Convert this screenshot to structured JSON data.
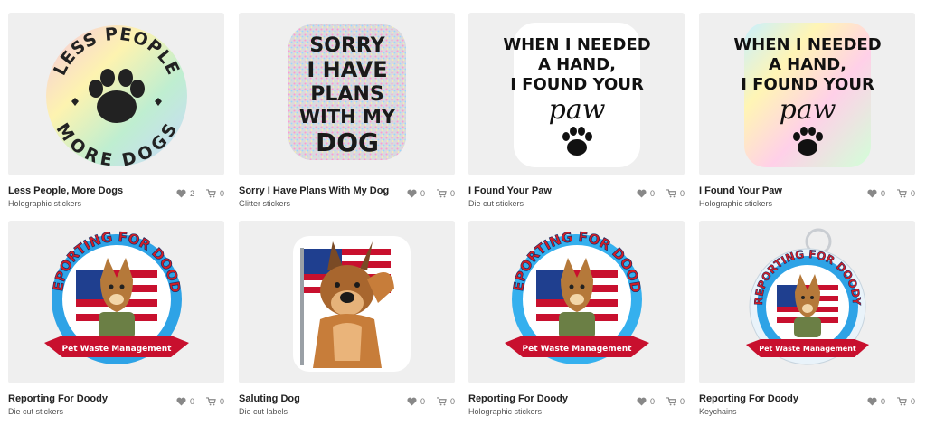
{
  "products": [
    {
      "title": "Less People, More Dogs",
      "subtitle": "Holographic stickers",
      "likes": "2",
      "cart": "0",
      "art": {
        "kind": "circle",
        "lines": [
          "LESS PEOPLE",
          "MORE DOGS"
        ]
      }
    },
    {
      "title": "Sorry I Have Plans With My Dog",
      "subtitle": "Glitter stickers",
      "likes": "0",
      "cart": "0",
      "art": {
        "kind": "glitter",
        "lines": [
          "SORRY",
          "I HAVE",
          "PLANS",
          "WITH MY",
          "DOG"
        ]
      }
    },
    {
      "title": "I Found Your Paw",
      "subtitle": "Die cut stickers",
      "likes": "0",
      "cart": "0",
      "art": {
        "kind": "paw-text",
        "lines": [
          "WHEN I NEEDED",
          "A HAND,",
          "I FOUND YOUR",
          "paw"
        ]
      }
    },
    {
      "title": "I Found Your Paw",
      "subtitle": "Holographic stickers",
      "likes": "0",
      "cart": "0",
      "art": {
        "kind": "paw-text-holo",
        "lines": [
          "WHEN I NEEDED",
          "A HAND,",
          "I FOUND YOUR",
          "paw"
        ]
      }
    },
    {
      "title": "Reporting For Doody",
      "subtitle": "Die cut stickers",
      "likes": "0",
      "cart": "0",
      "art": {
        "kind": "badge",
        "lines": [
          "REPORTING FOR DOODY",
          "Pet Waste Management"
        ]
      }
    },
    {
      "title": "Saluting Dog",
      "subtitle": "Die cut labels",
      "likes": "0",
      "cart": "0",
      "art": {
        "kind": "salute"
      }
    },
    {
      "title": "Reporting For Doody",
      "subtitle": "Holographic stickers",
      "likes": "0",
      "cart": "0",
      "art": {
        "kind": "badge",
        "lines": [
          "REPORTING FOR DOODY",
          "Pet Waste Management"
        ]
      }
    },
    {
      "title": "Reporting For Doody",
      "subtitle": "Keychains",
      "likes": "0",
      "cart": "0",
      "art": {
        "kind": "badge-key",
        "lines": [
          "REPORTING FOR DOODY",
          "Pet Waste Management"
        ]
      }
    }
  ],
  "colors": {
    "thumb_bg": "#efefef",
    "flag_red": "#c8102e",
    "flag_blue": "#1f3f8f",
    "badge_ring": "#2ea3e6"
  }
}
